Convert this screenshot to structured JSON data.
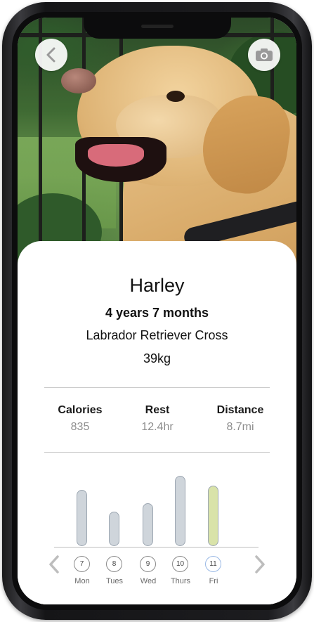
{
  "profile": {
    "name": "Harley",
    "age": "4 years 7 months",
    "breed": "Labrador Retriever Cross",
    "weight": "39kg"
  },
  "stats": [
    {
      "label": "Calories",
      "value": "835"
    },
    {
      "label": "Rest",
      "value": "12.4hr"
    },
    {
      "label": "Distance",
      "value": "8.7mi"
    }
  ],
  "icons": {
    "back": "chevron-left-icon",
    "camera": "camera-icon",
    "prev": "chevron-left-icon",
    "next": "chevron-right-icon"
  },
  "colors": {
    "bar_default": "#cfd5db",
    "bar_highlight": "#d9e3a9",
    "bar_outline": "#9da7b2",
    "accent_circle": "#9ab9e5"
  },
  "chart_data": {
    "type": "bar",
    "categories": [
      "Mon",
      "Tues",
      "Wed",
      "Thurs",
      "Fri"
    ],
    "dates": [
      "7",
      "8",
      "9",
      "10",
      "11"
    ],
    "values": [
      0.78,
      0.48,
      0.6,
      0.98,
      0.84
    ],
    "highlighted_index": 4
  }
}
